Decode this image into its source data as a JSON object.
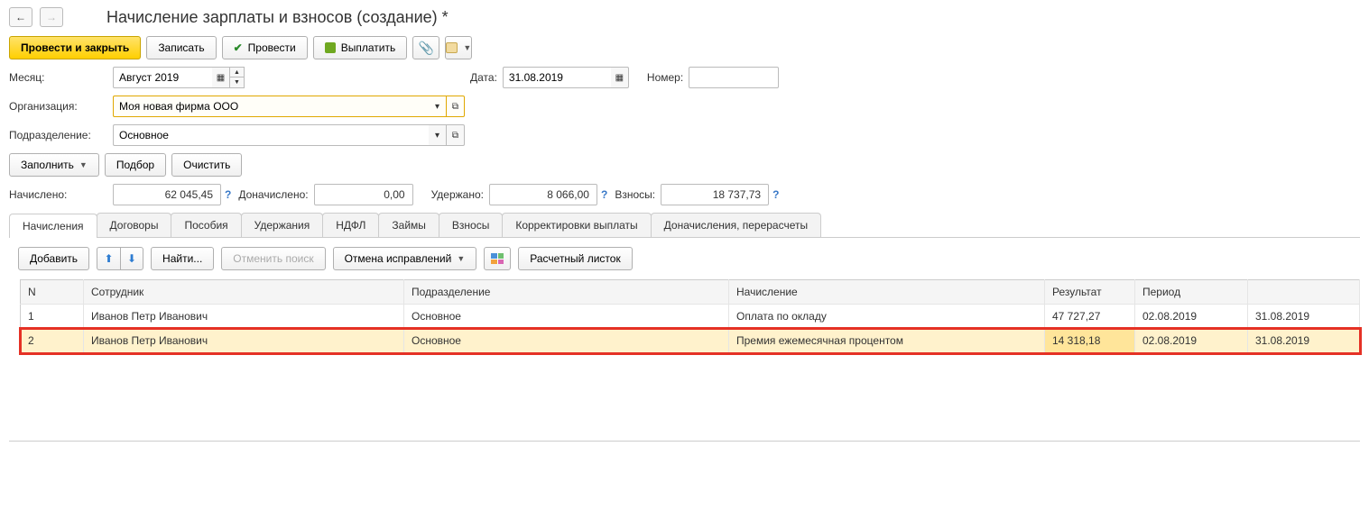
{
  "title": "Начисление зарплаты и взносов (создание) *",
  "toolbar": {
    "post_close": "Провести и закрыть",
    "save": "Записать",
    "post": "Провести",
    "pay": "Выплатить"
  },
  "fields": {
    "month_label": "Месяц:",
    "month_value": "Август 2019",
    "date_label": "Дата:",
    "date_value": "31.08.2019",
    "number_label": "Номер:",
    "number_value": "",
    "org_label": "Организация:",
    "org_value": "Моя новая фирма ООО",
    "dept_label": "Подразделение:",
    "dept_value": "Основное"
  },
  "actions": {
    "fill": "Заполнить",
    "pick": "Подбор",
    "clear": "Очистить"
  },
  "totals": {
    "accrued_label": "Начислено:",
    "accrued_value": "62 045,45",
    "extra_accrued_label": "Доначислено:",
    "extra_accrued_value": "0,00",
    "withheld_label": "Удержано:",
    "withheld_value": "8 066,00",
    "contrib_label": "Взносы:",
    "contrib_value": "18 737,73"
  },
  "tabs": [
    "Начисления",
    "Договоры",
    "Пособия",
    "Удержания",
    "НДФЛ",
    "Займы",
    "Взносы",
    "Корректировки выплаты",
    "Доначисления, перерасчеты"
  ],
  "subtoolbar": {
    "add": "Добавить",
    "find": "Найти...",
    "cancel_search": "Отменить поиск",
    "cancel_fix": "Отмена исправлений",
    "calc_sheet": "Расчетный листок"
  },
  "table": {
    "headers": {
      "n": "N",
      "employee": "Сотрудник",
      "department": "Подразделение",
      "accrual": "Начисление",
      "result": "Результат",
      "period": "Период"
    },
    "rows": [
      {
        "n": "1",
        "employee": "Иванов Петр Иванович",
        "department": "Основное",
        "accrual": "Оплата по окладу",
        "result": "47 727,27",
        "period_from": "02.08.2019",
        "period_to": "31.08.2019"
      },
      {
        "n": "2",
        "employee": "Иванов Петр Иванович",
        "department": "Основное",
        "accrual": "Премия ежемесячная процентом",
        "result": "14 318,18",
        "period_from": "02.08.2019",
        "period_to": "31.08.2019"
      }
    ]
  }
}
